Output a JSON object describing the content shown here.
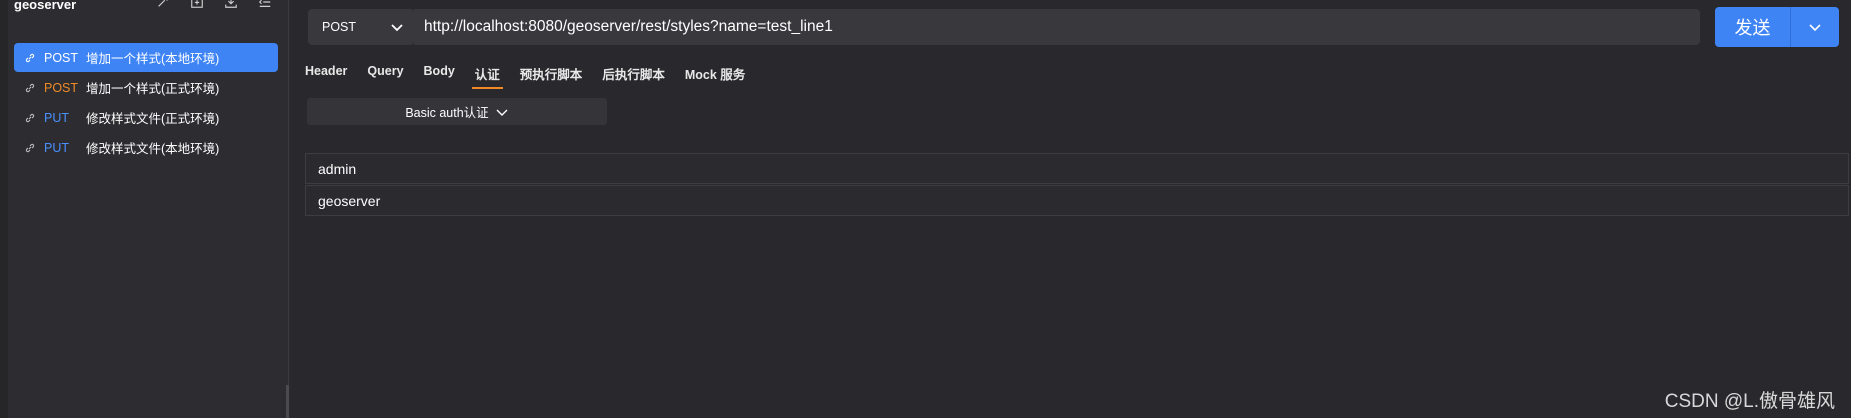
{
  "sidebar": {
    "title": "geoserver",
    "tools": [
      "magic-icon",
      "new-folder-icon",
      "import-icon",
      "collapse-icon"
    ],
    "items": [
      {
        "method": "POST",
        "name": "增加一个样式(本地环境)",
        "active": true
      },
      {
        "method": "POST",
        "name": "增加一个样式(正式环境)",
        "active": false
      },
      {
        "method": "PUT",
        "name": "修改样式文件(正式环境)",
        "active": false
      },
      {
        "method": "PUT",
        "name": "修改样式文件(本地环境)",
        "active": false
      }
    ]
  },
  "request": {
    "method": "POST",
    "url": "http://localhost:8080/geoserver/rest/styles?name=test_line1",
    "send_label": "发送"
  },
  "tabs": [
    {
      "label": "Header",
      "active": false
    },
    {
      "label": "Query",
      "active": false
    },
    {
      "label": "Body",
      "active": false
    },
    {
      "label": "认证",
      "active": true
    },
    {
      "label": "预执行脚本",
      "active": false
    },
    {
      "label": "后执行脚本",
      "active": false
    },
    {
      "label": "Mock 服务",
      "active": false
    }
  ],
  "auth": {
    "type": "Basic auth认证",
    "username": "admin",
    "password": "geoserver"
  },
  "watermark": "CSDN @L.傲骨雄风",
  "colors": {
    "accent": "#3e84f5",
    "post": "#f08a24",
    "put": "#4a90ff",
    "background": "#29292d"
  }
}
